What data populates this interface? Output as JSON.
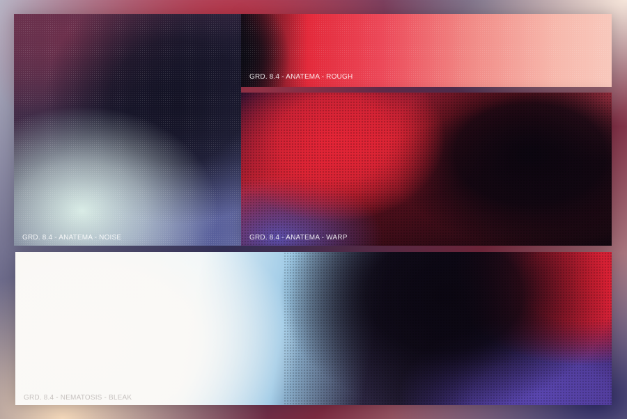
{
  "panels": {
    "noise": {
      "label": "GRD. 8.4 - ANATEMA - NOISE"
    },
    "rough": {
      "label": "GRD. 8.4 - ANATEMA - ROUGH"
    },
    "warp": {
      "label": "GRD. 8.4 - ANATEMA - WARP"
    },
    "bleak": {
      "label": "GRD. 8.4 - NEMATOSIS - BLEAK"
    }
  },
  "colors": {
    "red": "#e3293a",
    "dark": "#0b0610",
    "blue_violet": "#5a46b0",
    "pale": "#fbf9f6"
  }
}
